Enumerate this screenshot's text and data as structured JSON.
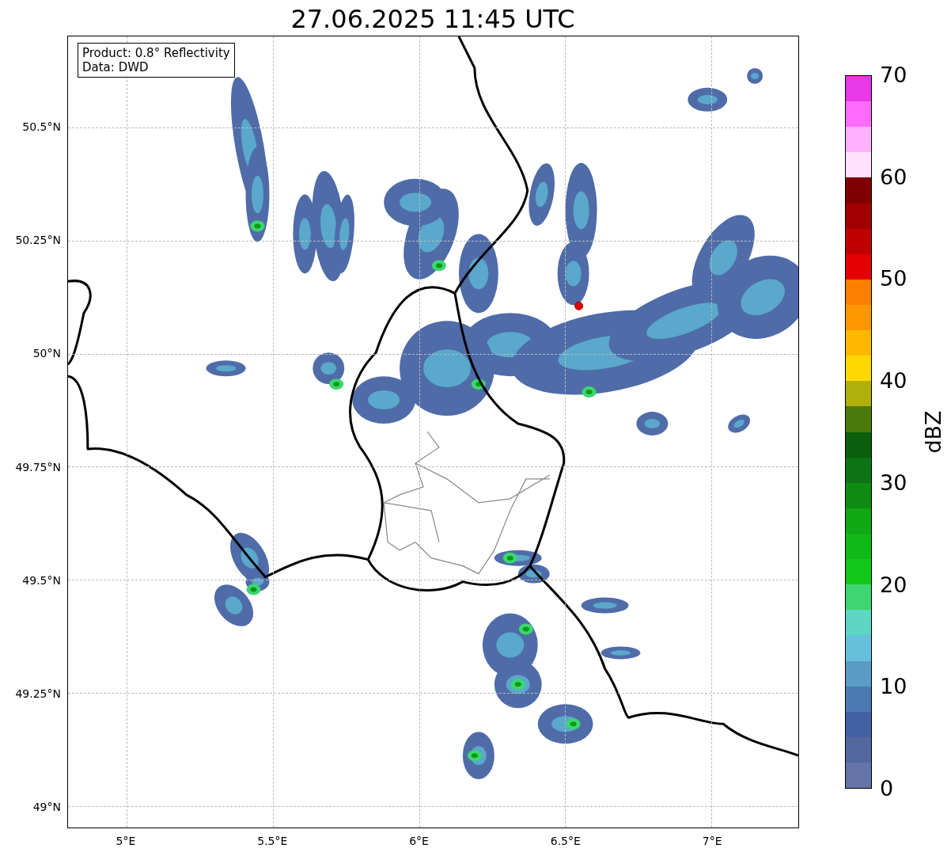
{
  "title": "27.06.2025 11:45 UTC",
  "map": {
    "legend": [
      "Product: 0.8° Reflectivity",
      "Data: DWD"
    ],
    "yticks": [
      "50.5°N",
      "50.25°N",
      "50°N",
      "49.75°N",
      "49.5°N",
      "49.25°N",
      "49°N"
    ],
    "xticks": [
      "5°E",
      "5.5°E",
      "6°E",
      "6.5°E",
      "7°E"
    ]
  },
  "colorbar": {
    "label": "dBZ",
    "ticks": [
      "70",
      "60",
      "50",
      "40",
      "30",
      "20",
      "10",
      "0"
    ],
    "segments": [
      {
        "color": "#e838e8"
      },
      {
        "color": "#ff6cff"
      },
      {
        "color": "#ffb0ff"
      },
      {
        "color": "#ffe0ff"
      },
      {
        "color": "#800000"
      },
      {
        "color": "#a00000"
      },
      {
        "color": "#c00000"
      },
      {
        "color": "#e40000"
      },
      {
        "color": "#ff8000"
      },
      {
        "color": "#ff9800"
      },
      {
        "color": "#ffb800"
      },
      {
        "color": "#ffd800"
      },
      {
        "color": "#b0b00a"
      },
      {
        "color": "#4a7a0c"
      },
      {
        "color": "#0a5e0c"
      },
      {
        "color": "#0c7414"
      },
      {
        "color": "#0e8c12"
      },
      {
        "color": "#10a814"
      },
      {
        "color": "#10b818"
      },
      {
        "color": "#12c818"
      },
      {
        "color": "#3dd670"
      },
      {
        "color": "#5ed6c4"
      },
      {
        "color": "#66c0dc"
      },
      {
        "color": "#5a9cc4"
      },
      {
        "color": "#4a7ab0"
      },
      {
        "color": "#4460a4"
      },
      {
        "color": "#5468a0"
      },
      {
        "color": "#6474a8"
      }
    ]
  }
}
